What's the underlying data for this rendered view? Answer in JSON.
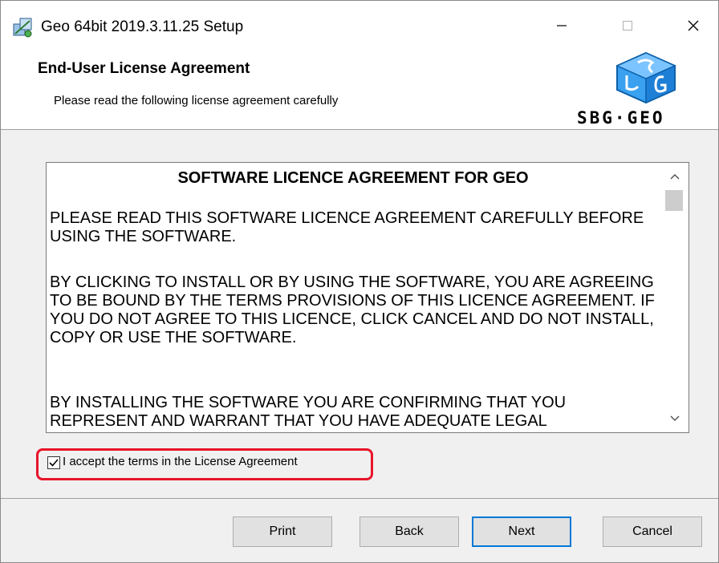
{
  "window": {
    "title": "Geo 64bit 2019.3.11.25 Setup",
    "controls": {
      "minimize": "minimize-icon",
      "maximize": "maximize-icon",
      "close": "close-icon"
    }
  },
  "header": {
    "title": "End-User License Agreement",
    "subtitle": "Please read the following license agreement carefully",
    "logo_text": "SBG·GEO"
  },
  "license": {
    "heading": "SOFTWARE LICENCE AGREEMENT FOR GEO",
    "paragraphs": [
      "PLEASE READ THIS SOFTWARE LICENCE AGREEMENT CAREFULLY BEFORE USING THE SOFTWARE.",
      "BY CLICKING TO INSTALL OR BY USING THE SOFTWARE, YOU ARE AGREEING TO BE BOUND BY THE TERMS PROVISIONS OF THIS LICENCE AGREEMENT. IF YOU DO NOT AGREE TO THIS LICENCE, CLICK CANCEL AND DO NOT INSTALL, COPY OR USE THE SOFTWARE.",
      "BY INSTALLING THE SOFTWARE YOU ARE CONFIRMING THAT YOU REPRESENT AND WARRANT THAT YOU HAVE ADEQUATE LEGAL"
    ]
  },
  "accept": {
    "label": "I accept the terms in the License Agreement",
    "checked": true
  },
  "buttons": {
    "print": "Print",
    "back": "Back",
    "next": "Next",
    "cancel": "Cancel"
  },
  "colors": {
    "highlight": "#e8152a",
    "focus_border": "#0078d7",
    "logo_blue": "#1e90ff"
  }
}
